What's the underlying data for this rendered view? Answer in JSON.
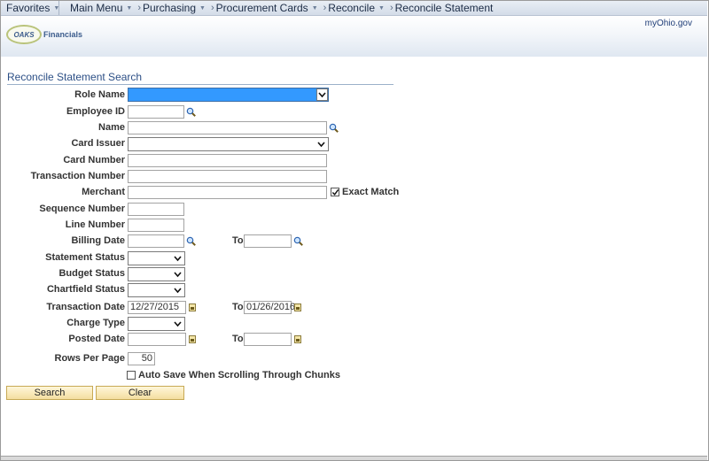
{
  "nav": {
    "favorites": "Favorites",
    "main_menu": "Main Menu",
    "crumbs": [
      "Purchasing",
      "Procurement Cards",
      "Reconcile",
      "Reconcile Statement"
    ]
  },
  "banner": {
    "logo_text": "OAKS",
    "logo_sub": "Financials",
    "link": "myOhio.gov"
  },
  "page": {
    "title": "Reconcile Statement Search"
  },
  "form": {
    "role_name": {
      "label": "Role Name",
      "value": ""
    },
    "employee_id": {
      "label": "Employee ID",
      "value": ""
    },
    "name": {
      "label": "Name",
      "value": ""
    },
    "card_issuer": {
      "label": "Card Issuer",
      "value": ""
    },
    "card_number": {
      "label": "Card Number",
      "value": ""
    },
    "transaction_number": {
      "label": "Transaction Number",
      "value": ""
    },
    "merchant": {
      "label": "Merchant",
      "value": ""
    },
    "exact_match": {
      "label": "Exact Match",
      "checked": true
    },
    "sequence_number": {
      "label": "Sequence Number",
      "value": ""
    },
    "line_number": {
      "label": "Line Number",
      "value": ""
    },
    "billing_date": {
      "label": "Billing Date",
      "from": "",
      "to": ""
    },
    "statement_status": {
      "label": "Statement Status",
      "value": ""
    },
    "budget_status": {
      "label": "Budget Status",
      "value": ""
    },
    "chartfield_status": {
      "label": "Chartfield Status",
      "value": ""
    },
    "transaction_date": {
      "label": "Transaction Date",
      "from": "12/27/2015",
      "to": "01/26/2016"
    },
    "charge_type": {
      "label": "Charge Type",
      "value": ""
    },
    "posted_date": {
      "label": "Posted Date",
      "from": "",
      "to": ""
    },
    "rows_per_page": {
      "label": "Rows Per Page",
      "value": "50"
    },
    "auto_save": {
      "label": "Auto Save When Scrolling Through Chunks",
      "checked": false
    },
    "to_label": "To"
  },
  "buttons": {
    "search": "Search",
    "clear": "Clear"
  },
  "colors": {
    "accent": "#3399ff",
    "title": "#2c4f86",
    "button": "#f4dea0"
  }
}
